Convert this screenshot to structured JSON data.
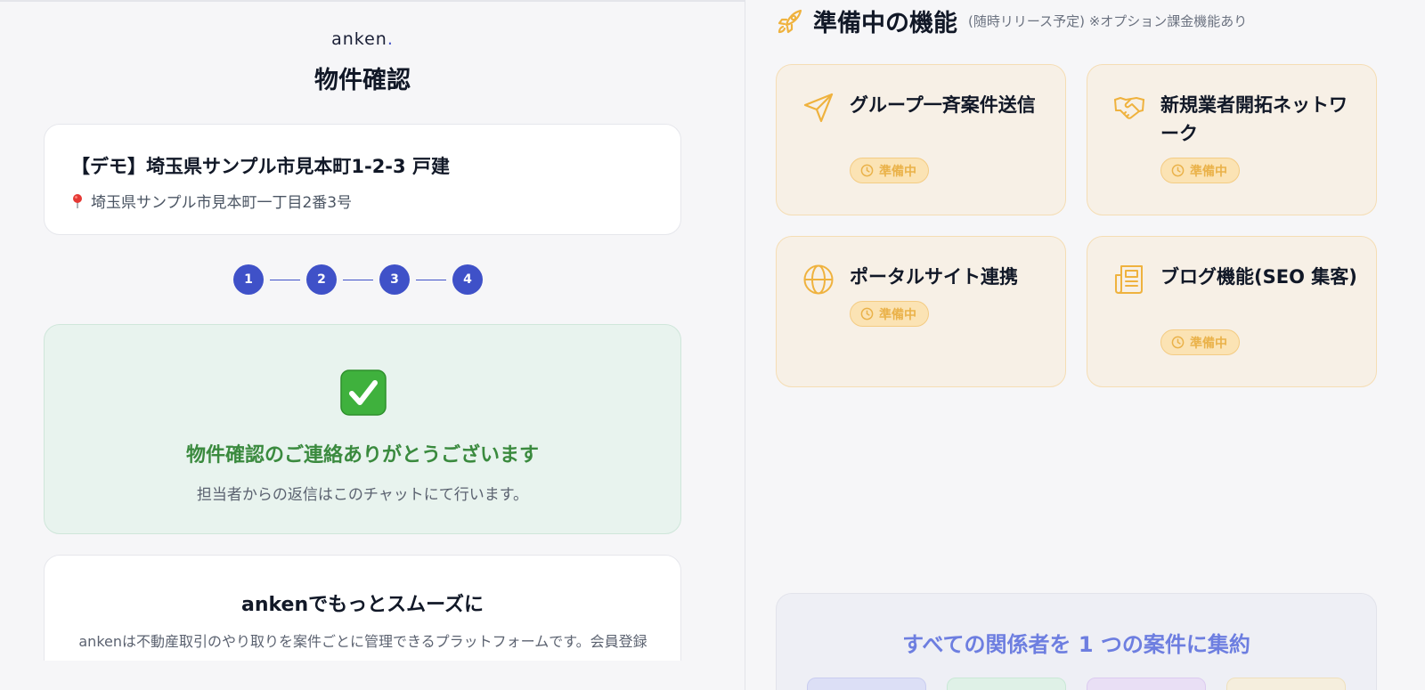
{
  "brand": {
    "name": "anken",
    "dot": "."
  },
  "page": {
    "title": "物件確認"
  },
  "property": {
    "title": "【デモ】埼玉県サンプル市見本町1-2-3 戸建",
    "address": "埼玉県サンプル市見本町一丁目2番3号",
    "pin_icon": "map-pin-icon"
  },
  "steps": [
    "1",
    "2",
    "3",
    "4"
  ],
  "success": {
    "icon": "check-mark-icon",
    "title": "物件確認のご連絡ありがとうございます",
    "subtitle": "担当者からの返信はこのチャットにて行います。"
  },
  "promo": {
    "title": "ankenでもっとスムーズに",
    "text": "ankenは不動産取引のやり取りを案件ごとに管理できるプラットフォームです。会員登録"
  },
  "features": {
    "title": "準備中の機能",
    "note": "(随時リリース予定) ※オプション課金機能あり",
    "icon": "rocket-icon",
    "items": [
      {
        "label": "グループ一斉案件送信",
        "badge": "準備中",
        "icon": "paper-plane-icon"
      },
      {
        "label": "新規業者開拓ネットワーク",
        "badge": "準備中",
        "icon": "handshake-icon"
      },
      {
        "label": "ポータルサイト連携",
        "badge": "準備中",
        "icon": "globe-icon"
      },
      {
        "label": "ブログ機能(SEO 集客)",
        "badge": "準備中",
        "icon": "newspaper-icon"
      }
    ]
  },
  "aggregate": {
    "title": "すべての関係者を 1 つの案件に集約"
  },
  "colors": {
    "accent": "#3f51c8",
    "success": "#3a8a3e",
    "pending": "#eab24a",
    "aggregate_title": "#6d7ee0"
  }
}
